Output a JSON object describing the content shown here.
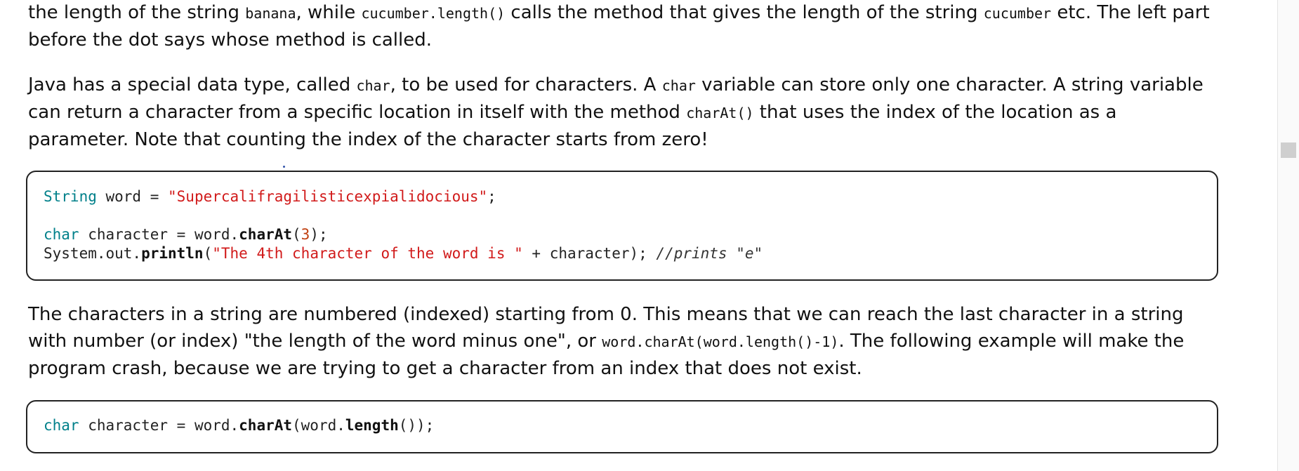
{
  "paragraph1": {
    "t1": "the length of the string ",
    "c1": "banana",
    "t2": ", while ",
    "c2": "cucumber.length()",
    "t3": " calls the method that gives the length of the string ",
    "c3": "cucumber",
    "t4": " etc. The left part before the dot says whose method is called."
  },
  "paragraph2": {
    "t1": "Java has a special data type, called ",
    "c1": "char",
    "t2": ", to be used for characters. A ",
    "c2": "char",
    "t3": " variable can store only one character. A string variable can return a character from a specific location in itself with the method ",
    "c3": "charAt()",
    "t4": " that uses the index of the location as a parameter. Note that counting the index of the character starts from zero!"
  },
  "code_block1": {
    "line1": {
      "type": "String",
      "rest": " word = ",
      "str": "\"Supercalifragilisticexpialidocious\"",
      "end": ";"
    },
    "line2": {
      "type": "char",
      "a": " character = word.",
      "method": "charAt",
      "b": "(",
      "num": "3",
      "c": ");"
    },
    "line3": {
      "a": "System.out.",
      "method": "println",
      "b": "(",
      "str": "\"The 4th character of the word is \"",
      "c": " + character); ",
      "comment": "//prints \"e\""
    }
  },
  "paragraph3": {
    "t1": "The characters in a string are numbered (indexed) starting from 0. This means that we can reach the last character in a string with number (or index) \"the length of the word minus one\", or ",
    "c1": "word.charAt(word.length()-1)",
    "t2": ". The following example will make the program crash, because we are trying to get a character from an index that does not exist."
  },
  "code_block2": {
    "line1": {
      "type": "char",
      "a": " character = word.",
      "method": "charAt",
      "b": "(word.",
      "method2": "length",
      "c": "());"
    }
  }
}
